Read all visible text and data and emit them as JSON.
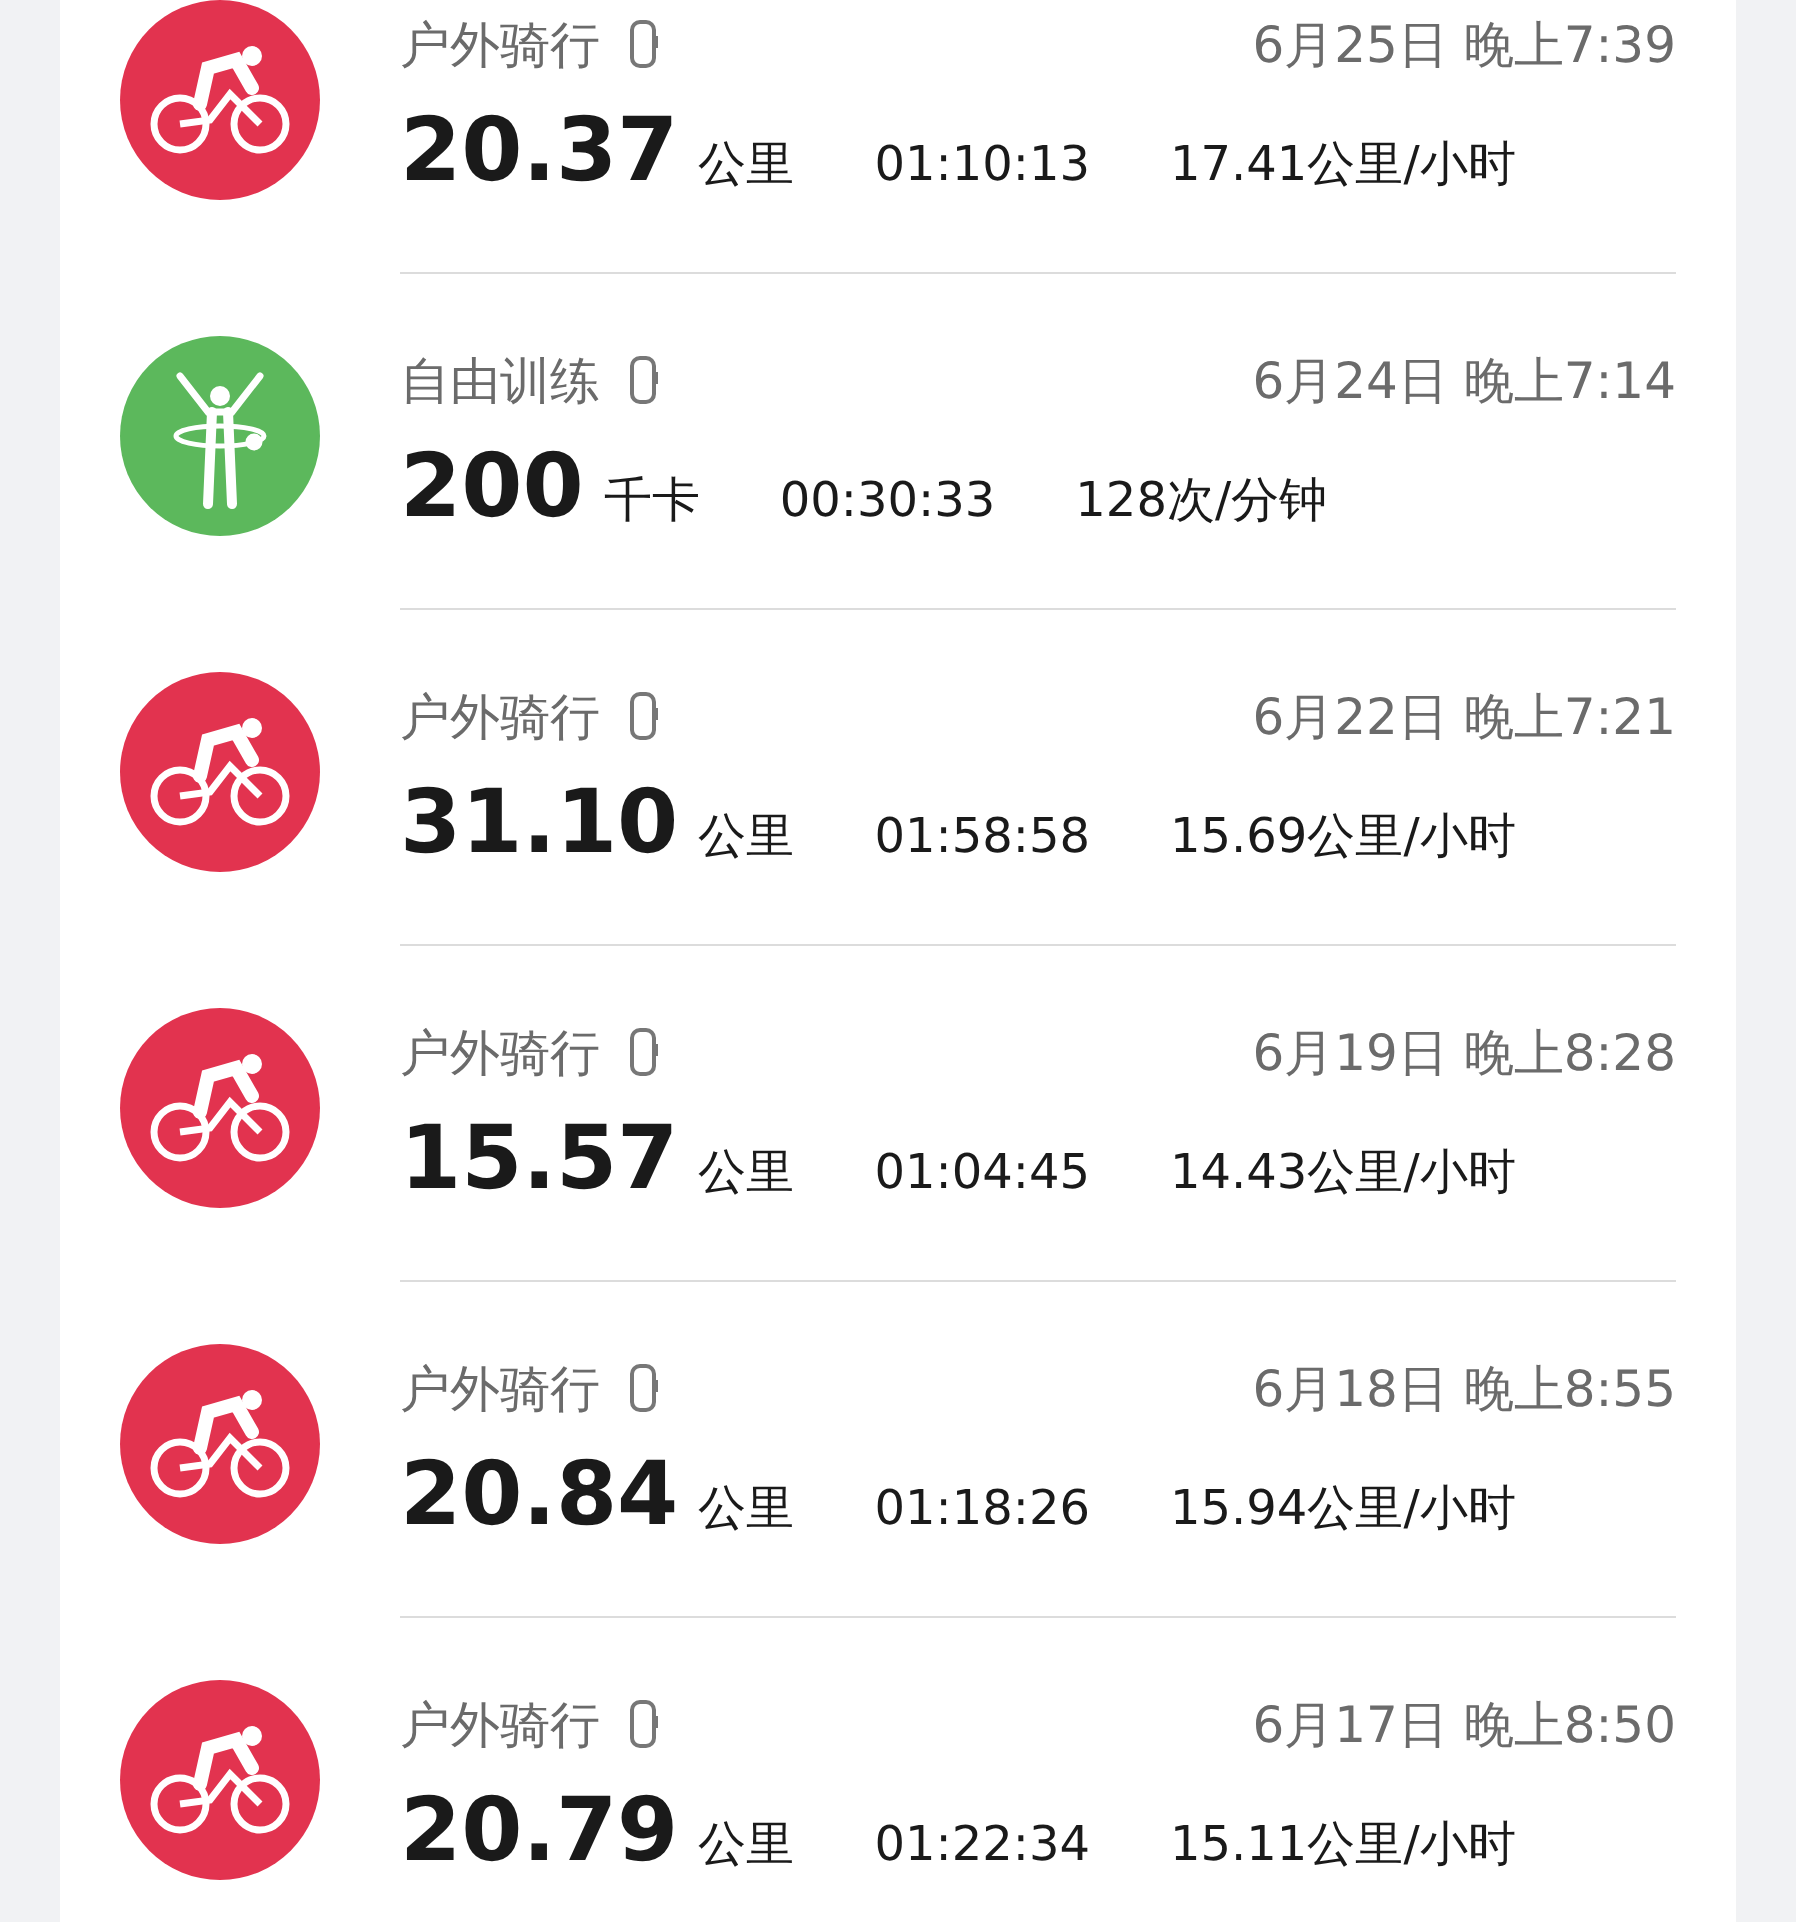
{
  "workouts": [
    {
      "kind": "cycling",
      "title": "户外骑行",
      "date": "6月25日 晚上7:39",
      "value": "20.37",
      "unit": "公里",
      "duration": "01:10:13",
      "rate": "17.41公里/小时"
    },
    {
      "kind": "free_training",
      "title": "自由训练",
      "date": "6月24日 晚上7:14",
      "value": "200",
      "unit": "千卡",
      "duration": "00:30:33",
      "rate": "128次/分钟"
    },
    {
      "kind": "cycling",
      "title": "户外骑行",
      "date": "6月22日 晚上7:21",
      "value": "31.10",
      "unit": "公里",
      "duration": "01:58:58",
      "rate": "15.69公里/小时"
    },
    {
      "kind": "cycling",
      "title": "户外骑行",
      "date": "6月19日 晚上8:28",
      "value": "15.57",
      "unit": "公里",
      "duration": "01:04:45",
      "rate": "14.43公里/小时"
    },
    {
      "kind": "cycling",
      "title": "户外骑行",
      "date": "6月18日 晚上8:55",
      "value": "20.84",
      "unit": "公里",
      "duration": "01:18:26",
      "rate": "15.94公里/小时"
    },
    {
      "kind": "cycling",
      "title": "户外骑行",
      "date": "6月17日 晚上8:50",
      "value": "20.79",
      "unit": "公里",
      "duration": "01:22:34",
      "rate": "15.11公里/小时"
    }
  ]
}
